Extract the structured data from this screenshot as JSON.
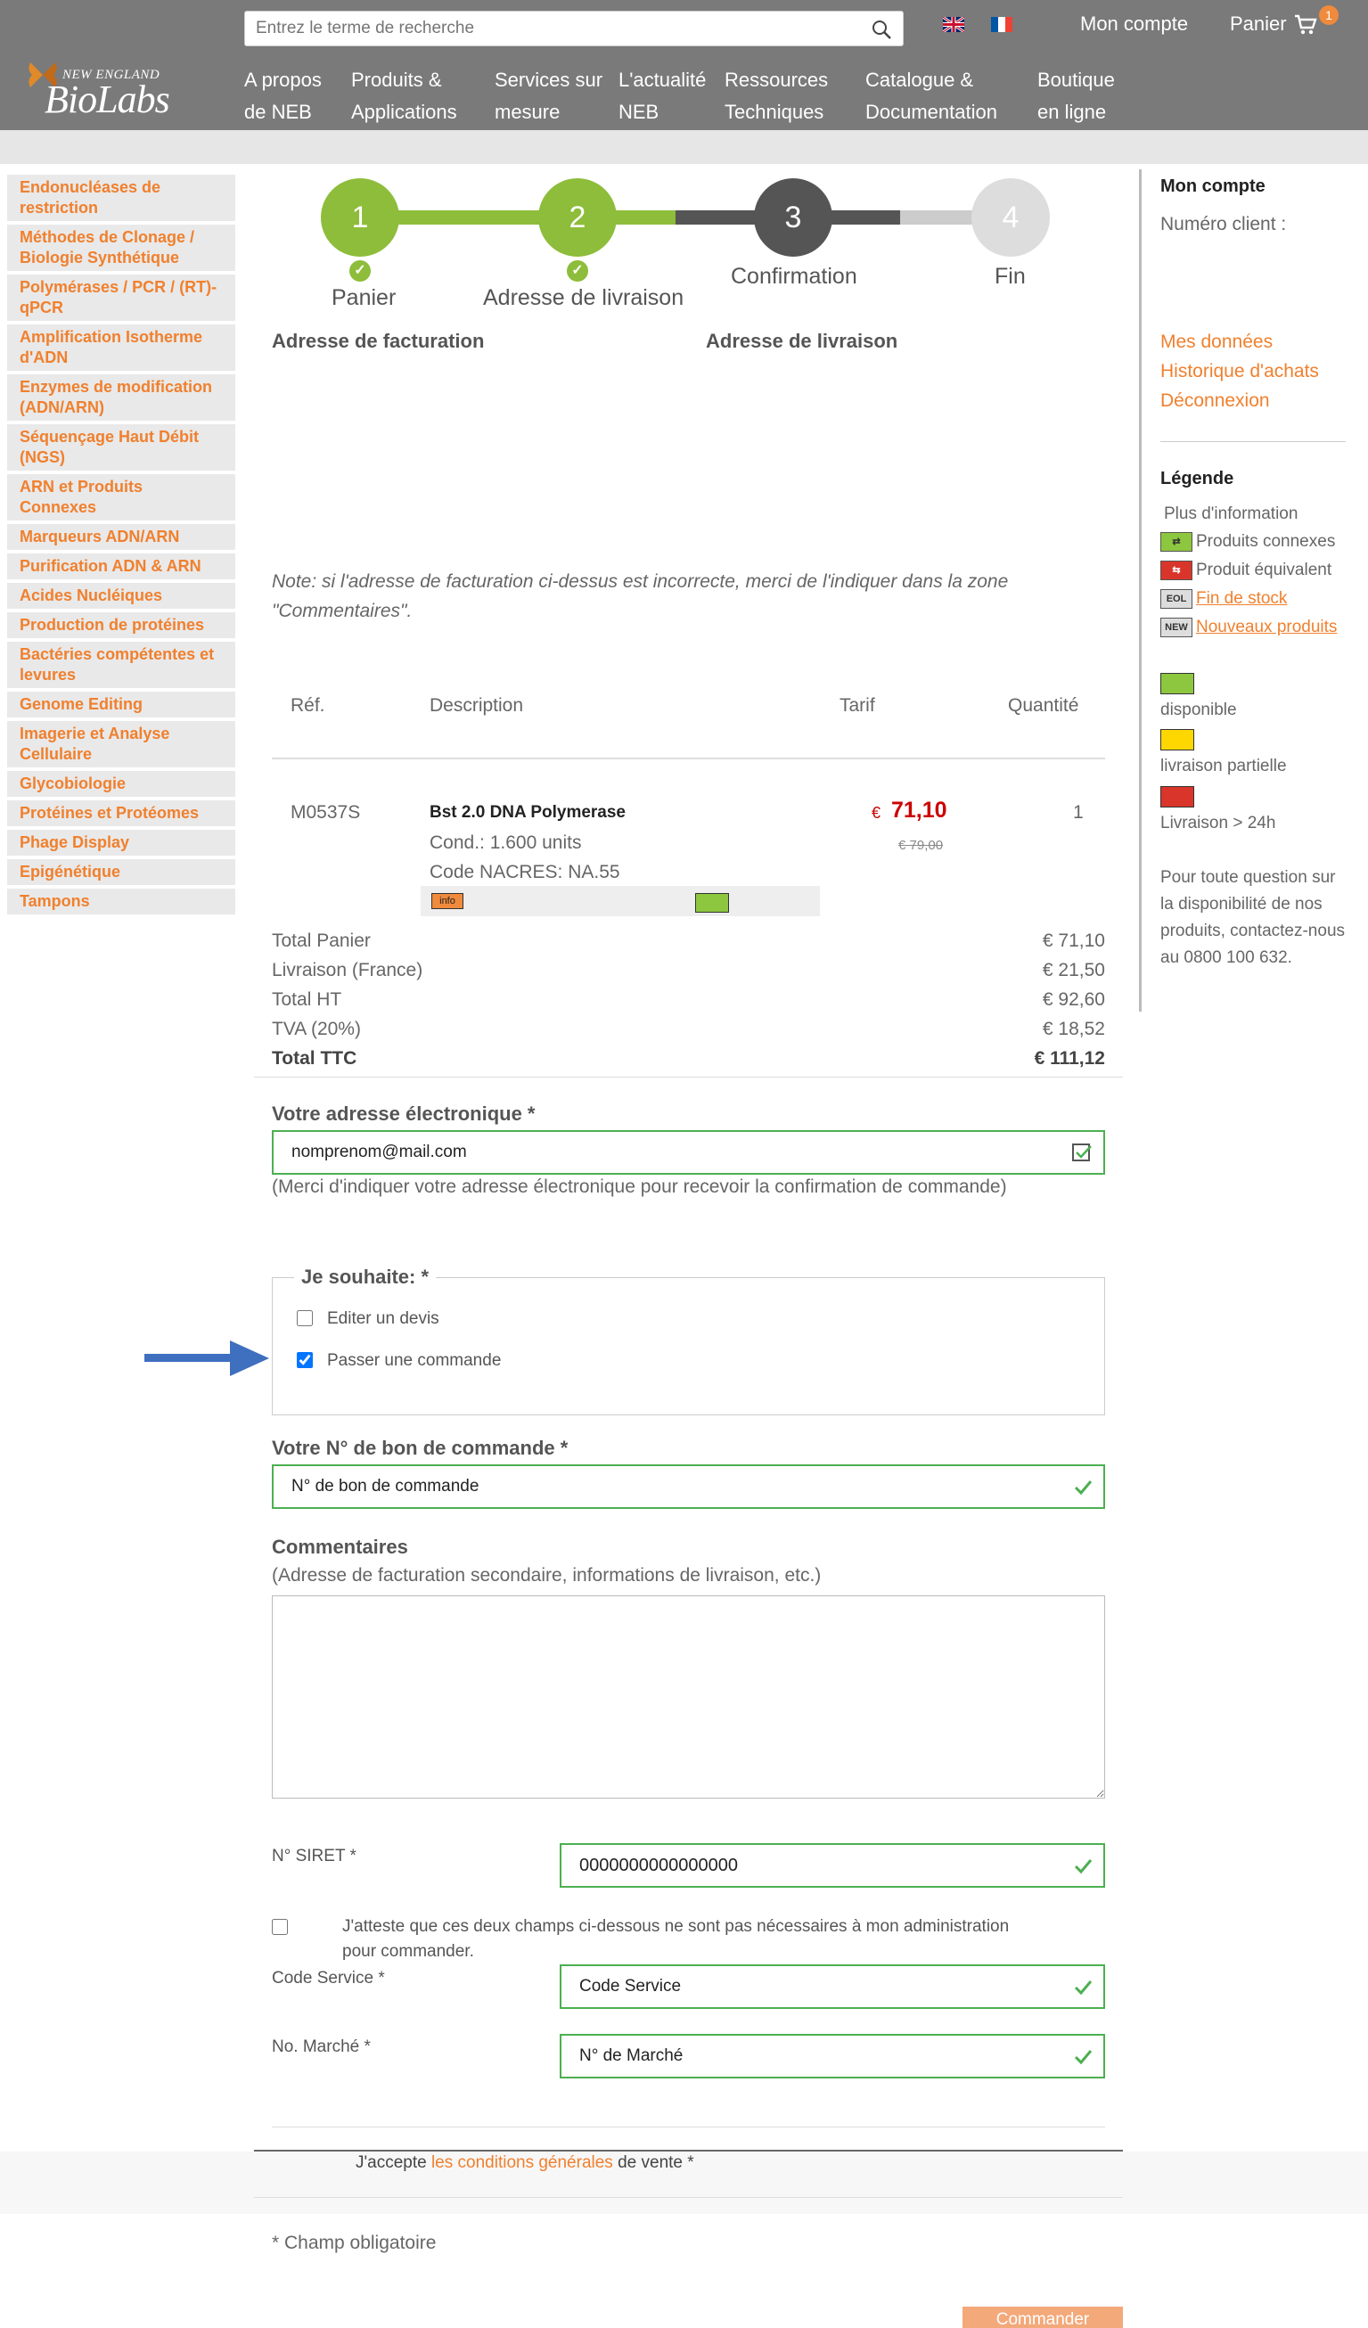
{
  "header": {
    "logo_line1": "NEW ENGLAND",
    "logo_line2": "BioLabs",
    "search_placeholder": "Entrez le terme de recherche",
    "account": "Mon compte",
    "cart": "Panier",
    "cart_count": "1",
    "nav": [
      {
        "l1": "A propos",
        "l2": "de NEB"
      },
      {
        "l1": "Produits &",
        "l2": "Applications"
      },
      {
        "l1": "Services sur",
        "l2": "mesure"
      },
      {
        "l1": "L'actualité",
        "l2": "NEB"
      },
      {
        "l1": "Ressources",
        "l2": "Techniques"
      },
      {
        "l1": "Catalogue &",
        "l2": "Documentation"
      },
      {
        "l1": "Boutique",
        "l2": "en ligne"
      }
    ]
  },
  "sidebar": {
    "items": [
      "Endonucléases de restriction",
      "Méthodes de Clonage / Biologie Synthétique",
      "Polymérases / PCR / (RT)-qPCR",
      "Amplification Isotherme d'ADN",
      "Enzymes de modification (ADN/ARN)",
      "Séquençage Haut Débit (NGS)",
      "ARN et Produits Connexes",
      "Marqueurs ADN/ARN",
      "Purification ADN & ARN",
      "Acides Nucléiques",
      "Production de protéines",
      "Bactéries compétentes et levures",
      "Genome Editing",
      "Imagerie et Analyse Cellulaire",
      "Glycobiologie",
      "Protéines et Protéomes",
      "Phage Display",
      "Epigénétique",
      "Tampons"
    ]
  },
  "steps": [
    {
      "num": "1",
      "label": "Panier"
    },
    {
      "num": "2",
      "label": "Adresse de livraison"
    },
    {
      "num": "3",
      "label": "Confirmation"
    },
    {
      "num": "4",
      "label": "Fin"
    }
  ],
  "addresses": {
    "billing": "Adresse de facturation",
    "shipping": "Adresse de livraison",
    "note": "Note: si l'adresse de facturation ci-dessus est incorrecte, merci de l'indiquer dans la zone \"Commentaires\"."
  },
  "table": {
    "headers": [
      "Réf.",
      "Description",
      "Tarif",
      "Quantité"
    ],
    "row": {
      "ref": "M0537S",
      "name": "Bst 2.0 DNA Polymerase",
      "cond": "Cond.: 1.600 units",
      "nacres": "Code NACRES: NA.55",
      "info": "info",
      "currency": "€",
      "price": "71,10",
      "old_price": "€ 79,00",
      "qty": "1"
    }
  },
  "totals": [
    {
      "label": "Total Panier",
      "value": "€ 71,10"
    },
    {
      "label": "Livraison (France)",
      "value": "€ 21,50"
    },
    {
      "label": "Total HT",
      "value": "€ 92,60"
    },
    {
      "label": "TVA (20%)",
      "value": "€ 18,52"
    },
    {
      "label": "Total TTC",
      "value": "€ 111,12"
    }
  ],
  "form": {
    "email_label": "Votre adresse électronique *",
    "email_value": "nomprenom@mail.com",
    "email_help": "(Merci d'indiquer votre adresse électronique pour recevoir la confirmation de commande)",
    "wish_legend": "Je souhaite: *",
    "opt_quote": "Editer un devis",
    "opt_order": "Passer une commande",
    "po_label": "Votre N° de bon de commande *",
    "po_value": "N° de bon de commande",
    "comments_label": "Commentaires",
    "comments_help": "(Adresse de facturation secondaire, informations de livraison, etc.)",
    "siret_label": "N° SIRET *",
    "siret_value": "0000000000000000",
    "attest": "J'atteste que ces deux champs ci-dessous ne sont pas nécessaires à mon administration pour commander.",
    "service_label": "Code Service *",
    "service_value": "Code Service",
    "market_label": "No. Marché *",
    "market_value": "N° de Marché",
    "accept_pre": "J'accepte ",
    "accept_link": "les conditions générales",
    "accept_post": " de vente *",
    "required_note": "* Champ obligatoire",
    "submit": "Commander"
  },
  "right": {
    "title": "Mon compte",
    "client": "Numéro client :",
    "links": [
      "Mes données",
      "Historique d'achats",
      "Déconnexion"
    ],
    "legend_title": "Légende",
    "legend_items": [
      {
        "icon": "info-legend-icon",
        "label": "Plus d'information"
      },
      {
        "icon": "related-products-icon",
        "label": "Produits connexes"
      },
      {
        "icon": "equivalent-product-icon",
        "label": "Produit équivalent"
      },
      {
        "icon": "EOL",
        "label": "Fin de stock"
      },
      {
        "icon": "NEW",
        "label": "Nouveaux produits"
      }
    ],
    "availability": [
      {
        "color": "#8dc63f",
        "label": "disponible"
      },
      {
        "color": "#ffd700",
        "label": "livraison partielle"
      },
      {
        "color": "#d9352a",
        "label": "Livraison > 24h"
      }
    ],
    "contact": "Pour toute question sur la disponibilité de nos produits, contactez-nous au 0800 100 632."
  },
  "colors": {
    "accent": "#f0802e",
    "green": "#8dbd3a",
    "dark": "#555555",
    "price": "#cc0000"
  }
}
